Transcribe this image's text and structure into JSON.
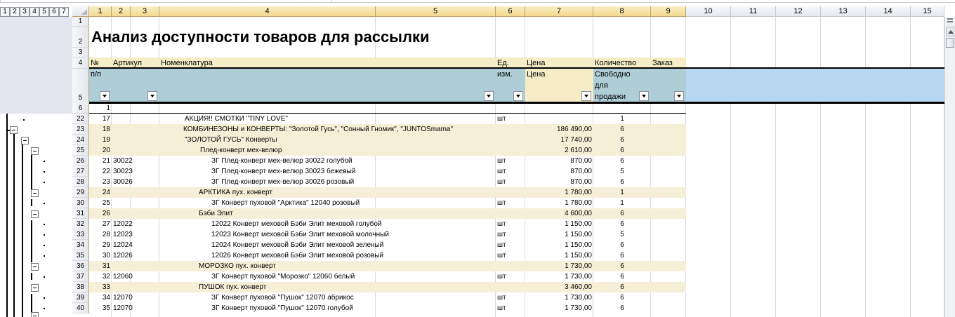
{
  "outline_levels": [
    "1",
    "2",
    "3",
    "4",
    "5",
    "6",
    "7"
  ],
  "columns": [
    "1",
    "2",
    "3",
    "4",
    "5",
    "6",
    "7",
    "8",
    "9",
    "10",
    "11",
    "12",
    "13",
    "14",
    "15"
  ],
  "title": "Анализ доступности товаров для рассылки",
  "header_row4": {
    "num": "№",
    "article": "Артикул",
    "name": "Номенклатура",
    "unit": "Ед.",
    "price": "Цена",
    "qty": "Количество",
    "order": "Заказ"
  },
  "header_row5": {
    "num": "п/п",
    "unit": "изм.",
    "price": "Цена",
    "qty": "Свободно\nдля\nпродажи"
  },
  "row6_value": "1",
  "rows": [
    {
      "row": "22",
      "num": "17",
      "article": "",
      "name": "АКЦИЯ!! СМОТКИ  \"TINY LOVE\"",
      "unit": "шт",
      "price": "",
      "qty": "1",
      "indent": 36,
      "shaded": false
    },
    {
      "row": "23",
      "num": "18",
      "article": "",
      "name": "КОМБИНЕЗОНЫ и КОНВЕРТЫ: \"Золотой Гусь\", \"Сонный Гномик\", \"JUNTOSmama\"",
      "unit": "",
      "price": "186 490,00",
      "qty": "6",
      "indent": 34,
      "shaded": true
    },
    {
      "row": "24",
      "num": "19",
      "article": "",
      "name": "\"ЗОЛОТОЙ ГУСЬ\"  Конверты",
      "unit": "",
      "price": "17 740,00",
      "qty": "6",
      "indent": 36,
      "shaded": true
    },
    {
      "row": "25",
      "num": "20",
      "article": "",
      "name": "Плед-конверт мех-велюр",
      "unit": "",
      "price": "2 610,00",
      "qty": "6",
      "indent": 58,
      "shaded": true
    },
    {
      "row": "26",
      "num": "21",
      "article": "30022",
      "name": "ЗГ Плед-конверт мех-велюр 30022 голубой",
      "unit": "шт",
      "price": "870,00",
      "qty": "6",
      "indent": 74,
      "shaded": false
    },
    {
      "row": "27",
      "num": "22",
      "article": "30023",
      "name": "ЗГ Плед-конверт мех-велюр 30023 бежевый",
      "unit": "шт",
      "price": "870,00",
      "qty": "5",
      "indent": 74,
      "shaded": false
    },
    {
      "row": "28",
      "num": "23",
      "article": "30026",
      "name": "ЗГ Плед-конверт мех-велюр 30026 розовый",
      "unit": "шт",
      "price": "870,00",
      "qty": "6",
      "indent": 74,
      "shaded": false
    },
    {
      "row": "29",
      "num": "24",
      "article": "",
      "name": "АРКТИКА пух. конверт",
      "unit": "",
      "price": "1 780,00",
      "qty": "1",
      "indent": 56,
      "shaded": true
    },
    {
      "row": "30",
      "num": "25",
      "article": "",
      "name": "ЗГ Конверт пуховой \"Арктика\" 12040 розовый",
      "unit": "шт",
      "price": "1 780,00",
      "qty": "1",
      "indent": 74,
      "shaded": false
    },
    {
      "row": "31",
      "num": "26",
      "article": "",
      "name": "Бэби Элит",
      "unit": "",
      "price": "4 600,00",
      "qty": "6",
      "indent": 56,
      "shaded": true
    },
    {
      "row": "32",
      "num": "27",
      "article": "12022",
      "name": "12022 Конверт меховой Бэби Элит меховой голубой",
      "unit": "шт",
      "price": "1 150,00",
      "qty": "6",
      "indent": 74,
      "shaded": false
    },
    {
      "row": "33",
      "num": "28",
      "article": "12023",
      "name": "12023 Конверт меховой Бэби Элит меховой молочный",
      "unit": "шт",
      "price": "1 150,00",
      "qty": "5",
      "indent": 74,
      "shaded": false
    },
    {
      "row": "34",
      "num": "29",
      "article": "12024",
      "name": "12024 Конверт меховой Бэби Элит меховой зеленый",
      "unit": "шт",
      "price": "1 150,00",
      "qty": "6",
      "indent": 74,
      "shaded": false
    },
    {
      "row": "35",
      "num": "30",
      "article": "12026",
      "name": "12026 Конверт меховой Бэби Элит меховой розовый",
      "unit": "шт",
      "price": "1 150,00",
      "qty": "6",
      "indent": 74,
      "shaded": false
    },
    {
      "row": "36",
      "num": "31",
      "article": "",
      "name": "МОРОЗКО пух. конверт",
      "unit": "",
      "price": "1 730,00",
      "qty": "6",
      "indent": 56,
      "shaded": true
    },
    {
      "row": "37",
      "num": "32",
      "article": "12060",
      "name": "ЗГ Конверт пуховой \"Морозко\" 12060 белый",
      "unit": "шт",
      "price": "1 730,00",
      "qty": "6",
      "indent": 74,
      "shaded": false
    },
    {
      "row": "38",
      "num": "33",
      "article": "",
      "name": "ПУШОК пух. конверт",
      "unit": "",
      "price": "3 460,00",
      "qty": "6",
      "indent": 56,
      "shaded": true
    },
    {
      "row": "39",
      "num": "34",
      "article": "12070",
      "name": "ЗГ Конверт пуховой \"Пушок\" 12070 абрикос",
      "unit": "шт",
      "price": "1 730,00",
      "qty": "6",
      "indent": 74,
      "shaded": false
    },
    {
      "row": "40",
      "num": "35",
      "article": "12070",
      "name": "ЗГ Конверт пуховой \"Пушок\" 12070 голубой",
      "unit": "шт",
      "price": "1 730,00",
      "qty": "6",
      "indent": 74,
      "shaded": false
    }
  ],
  "row_labels_top": [
    "1",
    "2",
    "3",
    "4",
    "5",
    "6"
  ],
  "icons": {
    "filter": "dropdown-filter-icon",
    "collapse": "outline-collapse-icon",
    "scroll_up": "scroll-up-arrow-icon"
  }
}
